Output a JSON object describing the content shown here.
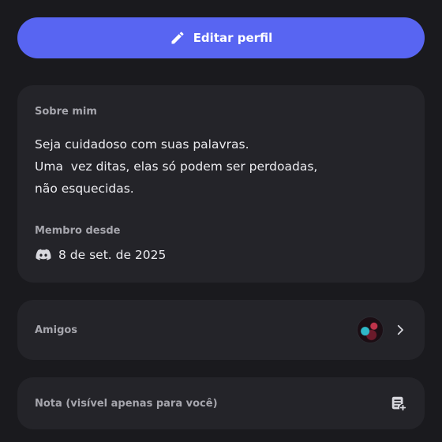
{
  "edit_button": {
    "label": "Editar perfil",
    "icon": "pencil-icon"
  },
  "about": {
    "label": "Sobre mim",
    "bio_lines": [
      "Seja cuidadoso com suas palavras.",
      "Uma  vez ditas, elas só podem ser perdoadas,",
      "não esquecidas."
    ],
    "member_since_label": "Membro desde",
    "member_since_value": "8 de set. de 2025",
    "member_icon": "discord-icon"
  },
  "friends": {
    "label": "Amigos",
    "icon": "chevron-right-icon"
  },
  "note": {
    "placeholder": "Nota (visível apenas para você)",
    "icon": "note-add-icon"
  },
  "colors": {
    "accent": "#5865f2",
    "background": "#1a1a1e",
    "card": "#242429"
  }
}
